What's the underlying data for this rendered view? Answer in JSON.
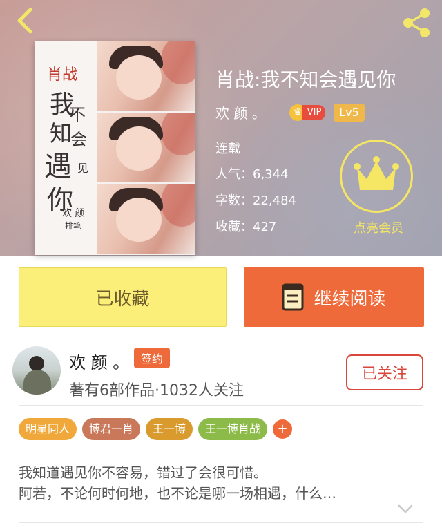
{
  "header": {
    "title": "肖战:我不知会遇见你",
    "author": "欢 颜 。",
    "vip_label": "VIP",
    "level_label": "Lv5",
    "status": "连载",
    "popularity_label": "人气：",
    "popularity_value": "6,344",
    "words_label": "字数：",
    "words_value": "22,484",
    "favorites_label": "收藏：",
    "favorites_value": "427",
    "member_label": "点亮会员"
  },
  "cover": {
    "calligraphy": [
      "肖战",
      "我",
      "不",
      "知",
      "会",
      "遇",
      "见",
      "你",
      "欢 颜",
      "排笔"
    ]
  },
  "actions": {
    "collect_label": "已收藏",
    "read_label": "继续阅读"
  },
  "author_card": {
    "name": "欢 颜 。",
    "badge": "签约",
    "meta": "著有6部作品·1032人关注",
    "follow_label": "已关注"
  },
  "tags": [
    {
      "label": "明星同人",
      "color": "#f0a83a"
    },
    {
      "label": "博君一肖",
      "color": "#c9785a"
    },
    {
      "label": "王一博",
      "color": "#d99a2e"
    },
    {
      "label": "王一博肖战",
      "color": "#8dbb4a"
    }
  ],
  "tag_add": "+",
  "description": {
    "line1": "我知道遇见你不容易，错过了会很可惜。",
    "line2": "阿若，不论何时何地，也不论是哪一场相遇，什么…"
  },
  "colors": {
    "accent": "#ef6a3a",
    "collect_bg": "#fbef7a",
    "member_gold": "#f5e663"
  }
}
